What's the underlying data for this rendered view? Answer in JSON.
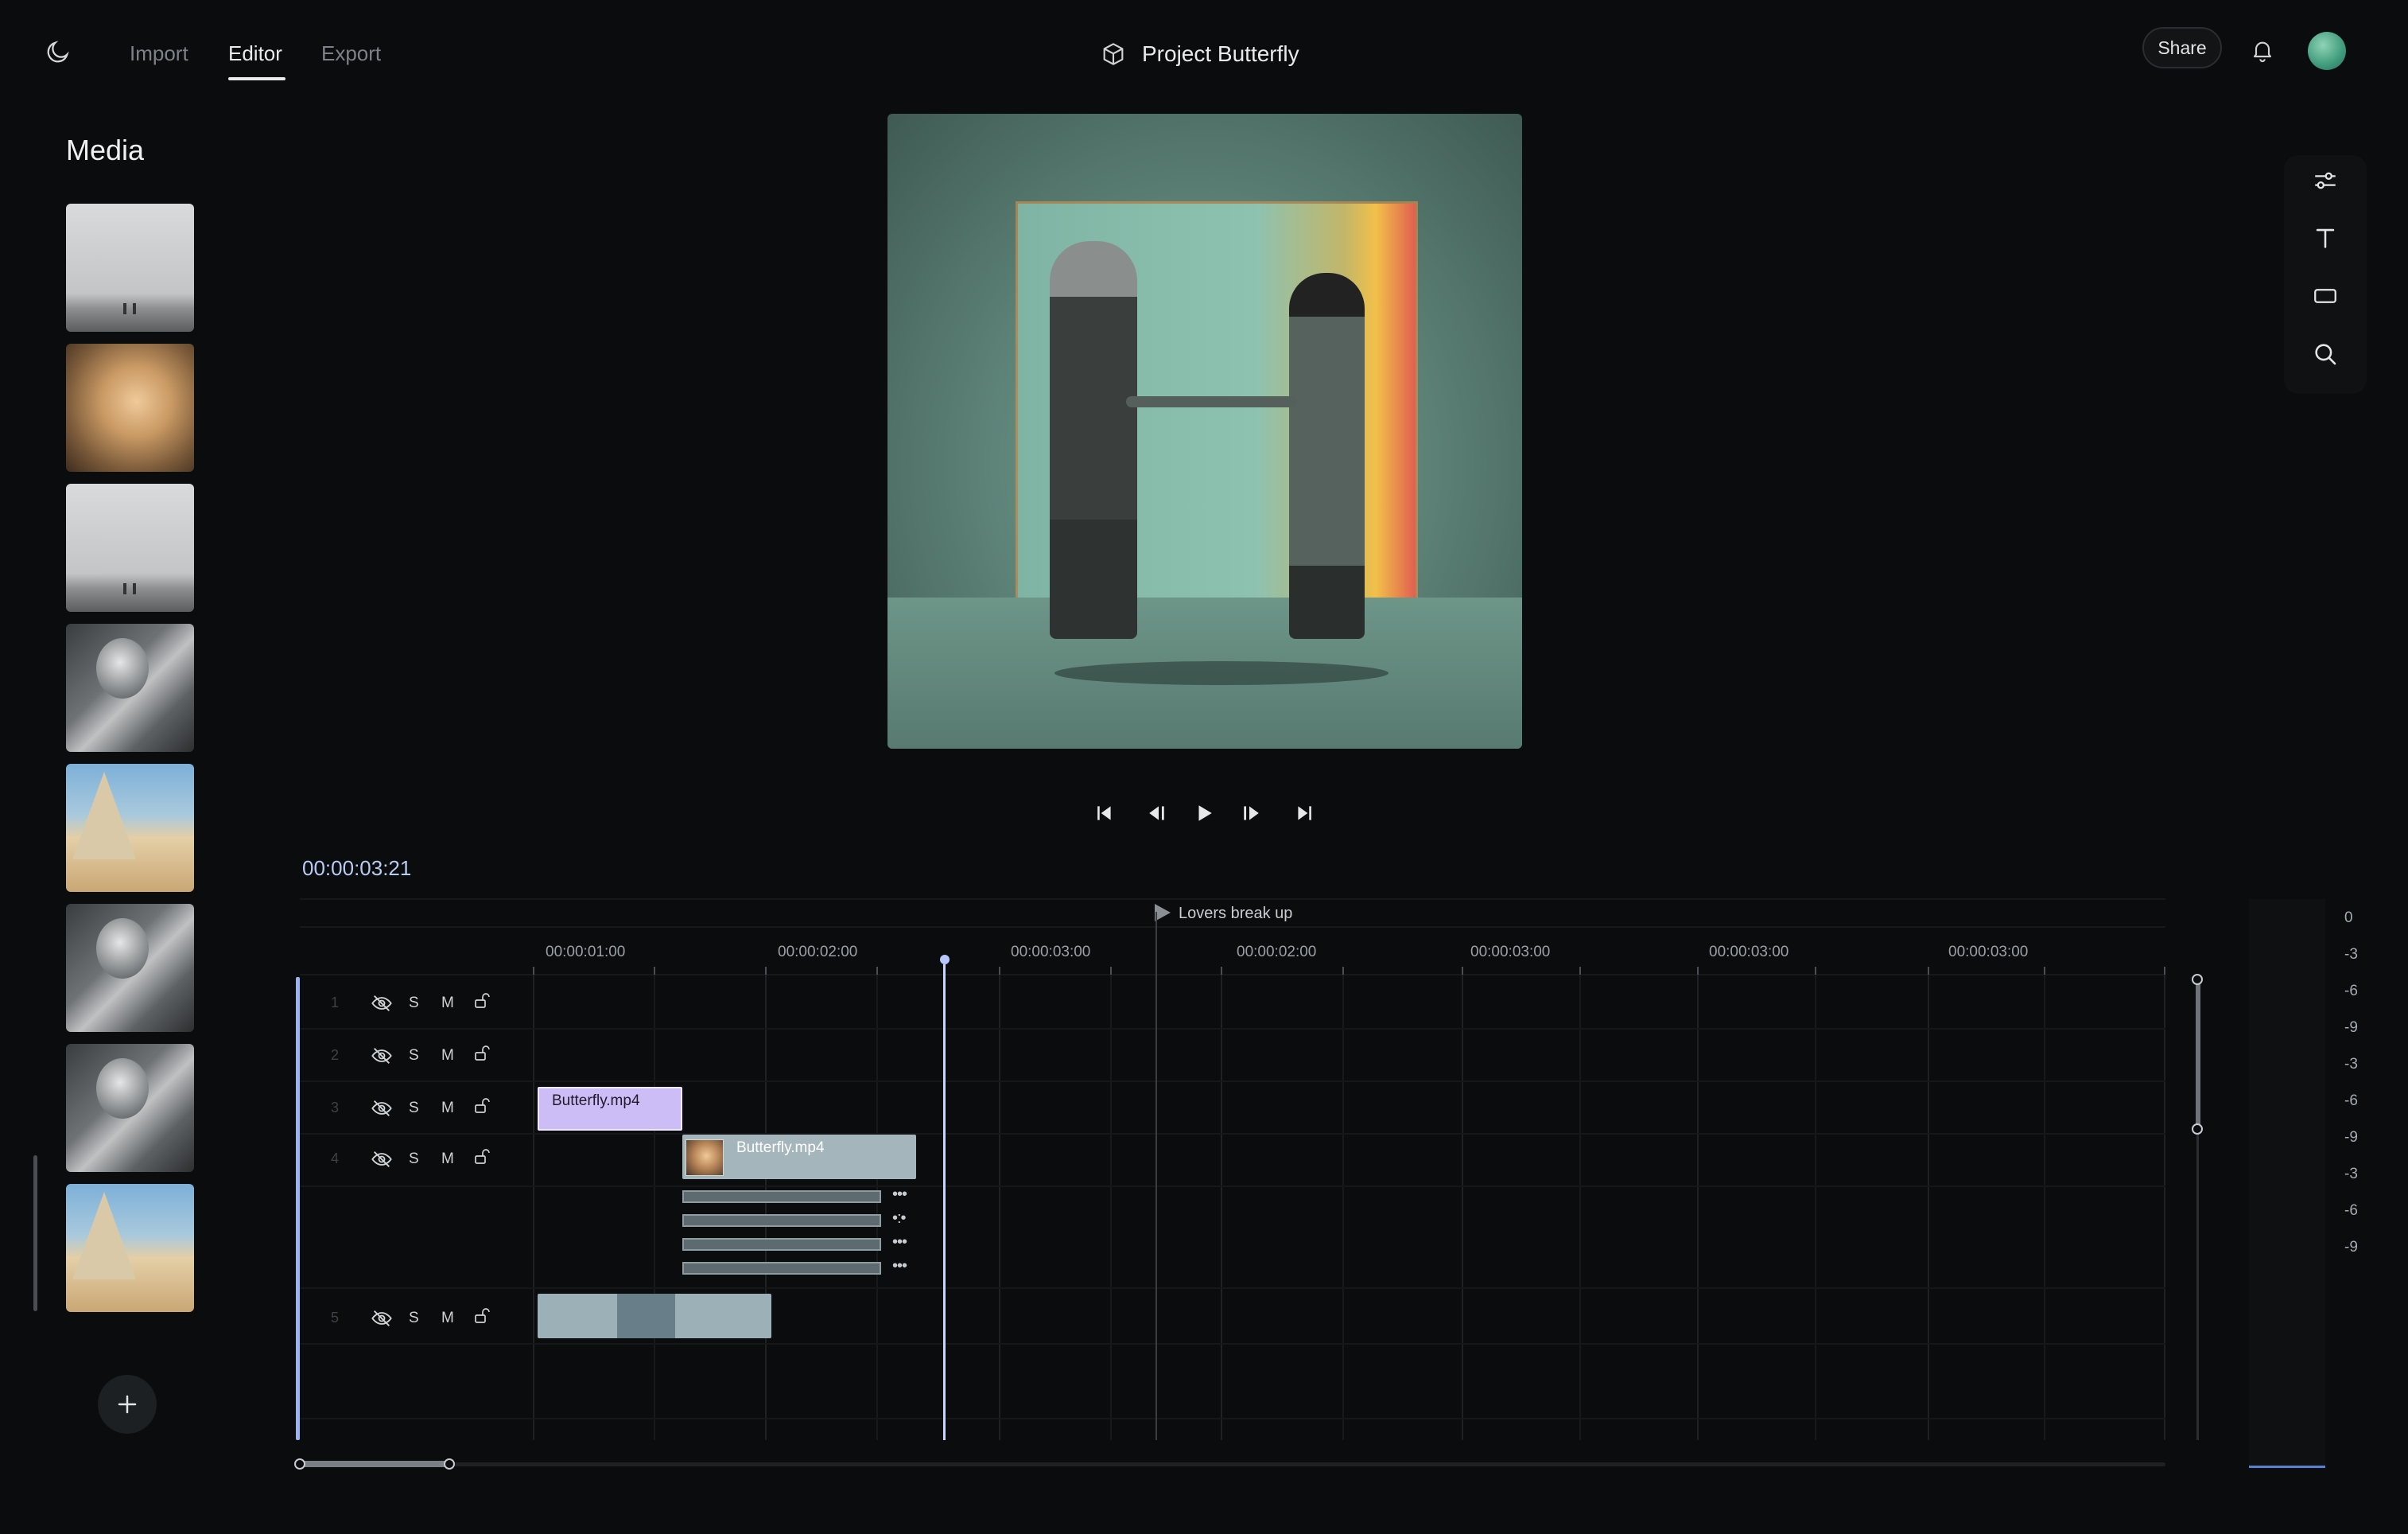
{
  "nav": {
    "tabs": [
      {
        "label": "Import"
      },
      {
        "label": "Editor"
      },
      {
        "label": "Export"
      }
    ],
    "project_title": "Project Butterfly",
    "share_label": "Share"
  },
  "media": {
    "title": "Media",
    "items": [
      "fog-beach",
      "desert-man",
      "fog-beach",
      "glitch-man",
      "desert-tent",
      "glitch-man",
      "glitch-man",
      "desert-tent"
    ]
  },
  "timeline": {
    "timecode": "00:00:03:21",
    "marker_label": "Lovers break up",
    "ruler_labels": [
      "00:00:01:00",
      "00:00:02:00",
      "00:00:03:00",
      "00:00:02:00",
      "00:00:03:00",
      "00:00:03:00",
      "00:00:03:00"
    ],
    "tracks": [
      {
        "number": "1",
        "solo": "S",
        "mute": "M"
      },
      {
        "number": "2",
        "solo": "S",
        "mute": "M"
      },
      {
        "number": "3",
        "solo": "S",
        "mute": "M"
      },
      {
        "number": "4",
        "solo": "S",
        "mute": "M"
      },
      {
        "number": "5",
        "solo": "S",
        "mute": "M"
      }
    ],
    "clips": [
      {
        "name": "Butterfly.mp4"
      },
      {
        "name": "Butterfly.mp4"
      }
    ],
    "sub_dots": [
      "•••",
      "•:•",
      "•••",
      "•••"
    ]
  },
  "meter": {
    "labels": [
      "0",
      "-3",
      "-6",
      "-9",
      "-3",
      "-6",
      "-9",
      "-3",
      "-6",
      "-9"
    ]
  },
  "colors": {
    "accent": "#c9d3ff",
    "clip_selected": "#cdbdf7",
    "clip": "#a4b6bc"
  }
}
